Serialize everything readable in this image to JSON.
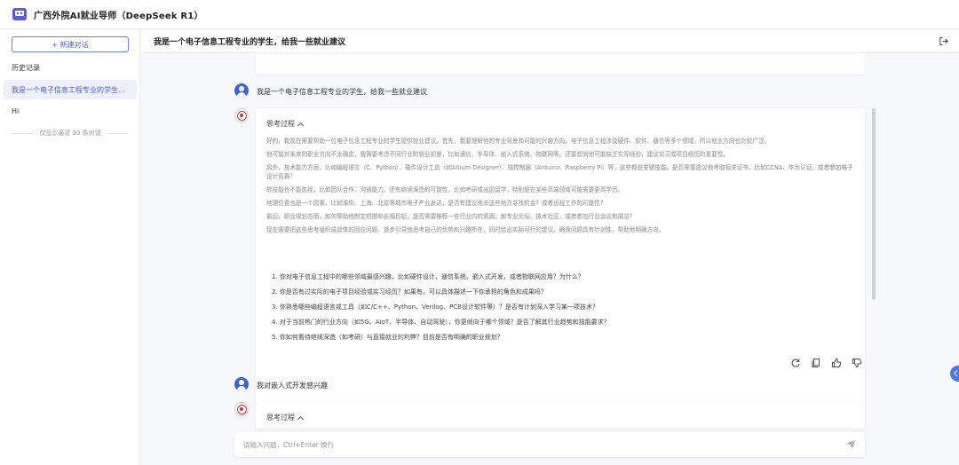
{
  "app": {
    "title": "广西外院AI就业导师（DeepSeek R1）"
  },
  "sidebar": {
    "new_chat_label": "+ 新建对话",
    "history_label": "历史记录",
    "items": [
      {
        "label": "我是一个电子信息工程专业的学生..."
      },
      {
        "label": "Hi"
      }
    ],
    "note": "仅显示最近 20 条对话"
  },
  "header": {
    "title": "我是一个电子信息工程专业的学生，给我一些就业建议"
  },
  "messages": {
    "user1": "我是一个电子信息工程专业的学生，给我一些就业建议",
    "think_label": "思考过程",
    "thinking": [
      "好的，我现在需要帮助一位电子信息工程专业的学生提供就业建议。首先，我要理解他的专业背景和可能的兴趣方向。电子信息工程涉及硬件、软件、通信等多个领域，所以就业方向也比较广泛。",
      "他可能对未来的职业方向不太确定，我需要考虑不同行业的就业前景，比如通信、半导体、嵌入式系统、物联网等。还要想到他可能缺乏实际经验，建议实习或项目经历的重要性。",
      "另外，技术能力方面，比如编程语言（C、Python）、硬件设计工具（如Altium Designer）、微控制器（Arduino、Raspberry Pi）等，这些都是关键技能。是否需要建议他考取相关证书，比如CCNA、华为认证，或者参加电子设计竞赛？",
      "软技能也不能忽视，比如团队合作、沟通能力。还有继续深造的可能性，比如考研或出国留学，特别是在某些高端领域可能需要更高学历。",
      "地理位置也是一个因素，比如深圳、上海、北京等城市电子产业发达，是否有建议他去这些地方寻找机会？或者远程工作的可能性？",
      "最后，职业规划方面，如何帮助他制定短期和长期目标，是否需要推荐一些行业内的资源，如专业论坛、技术社区，或者参加行业会议和展览？",
      "现在需要把这些思考组织成具体的回应问题，逐步引导他思考自己的优势和兴趣所在，同时给出实际可行的建议。确保问题具有针对性，帮助他明确方向。"
    ],
    "questions": [
      "1. 你对电子信息工程中的哪些领域最感兴趣，比如硬件设计、通信系统、嵌入式开发，或者物联网应用？为什么？",
      "2. 你是否有过实际的电子项目经验或实习经历？如果有，可以具体描述一下你承担的角色和成果吗？",
      "3. 你熟悉哪些编程语言或工具（如C/C++、Python、Verilog、PCB设计软件等）？是否有计划深入学习某一项技术？",
      "4. 对于当前热门的行业方向（如5G、AIoT、半导体、自动驾驶），你更倾向于哪个领域？是否了解其行业趋势和技能要求？",
      "5. 你如何看待继续深造（如考研）与直接就业的利弊？目前是否有明确的职业规划？"
    ],
    "user2": "我对嵌入式开发感兴趣",
    "think_label2": "思考过程"
  },
  "input": {
    "placeholder": "请输入问题，Ctrl+Enter 换行"
  },
  "icons": {
    "logo": "chat-bot-logo-icon",
    "export": "logout-icon",
    "actions": [
      "refresh-icon",
      "copy-icon",
      "thumbs-up-icon",
      "thumbs-down-icon"
    ],
    "send": "send-icon"
  },
  "colors": {
    "accent": "#4c5bd4",
    "user_avatar": "#3f63d6",
    "bot_seal": "#c23a3a"
  }
}
